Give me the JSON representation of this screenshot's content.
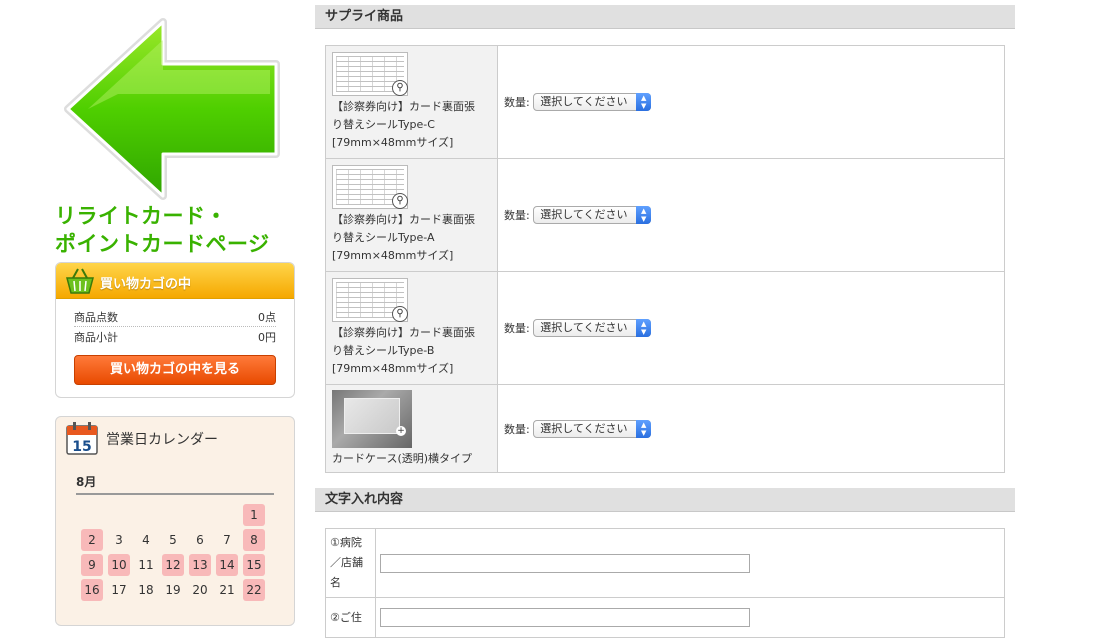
{
  "sidebar": {
    "banner": {
      "text_line1": "リライトカード・",
      "text_line2": "ポイントカードページ",
      "icon": "green-left-arrow-icon"
    },
    "cart": {
      "title": "買い物カゴの中",
      "rows": [
        {
          "label": "商品点数",
          "value": "0点"
        },
        {
          "label": "商品小計",
          "value": "0円"
        }
      ],
      "button_label": "買い物カゴの中を見る"
    },
    "calendar": {
      "title": "営業日カレンダー",
      "icon_day": "15",
      "month": "8月",
      "days": [
        {
          "d": "1",
          "holiday": true
        },
        {
          "d": "2",
          "holiday": true
        },
        {
          "d": "3",
          "holiday": false
        },
        {
          "d": "4",
          "holiday": false
        },
        {
          "d": "5",
          "holiday": false
        },
        {
          "d": "6",
          "holiday": false
        },
        {
          "d": "7",
          "holiday": false
        },
        {
          "d": "8",
          "holiday": true
        },
        {
          "d": "9",
          "holiday": true
        },
        {
          "d": "10",
          "holiday": true
        },
        {
          "d": "11",
          "holiday": false
        },
        {
          "d": "12",
          "holiday": true
        },
        {
          "d": "13",
          "holiday": true
        },
        {
          "d": "14",
          "holiday": true
        },
        {
          "d": "15",
          "holiday": true
        },
        {
          "d": "16",
          "holiday": true
        },
        {
          "d": "17",
          "holiday": false
        },
        {
          "d": "18",
          "holiday": false
        },
        {
          "d": "19",
          "holiday": false
        },
        {
          "d": "20",
          "holiday": false
        },
        {
          "d": "21",
          "holiday": false
        },
        {
          "d": "22",
          "holiday": true
        }
      ]
    }
  },
  "supply": {
    "heading": "サプライ商品",
    "qty_label": "数量:",
    "select_placeholder": "選択してください",
    "products": [
      {
        "line1": "【診察券向け】カード裏面張",
        "line2": "り替えシールType-C",
        "line3": "[79mm×48mmサイズ]"
      },
      {
        "line1": "【診察券向け】カード裏面張",
        "line2": "り替えシールType-A",
        "line3": "[79mm×48mmサイズ]"
      },
      {
        "line1": "【診察券向け】カード裏面張",
        "line2": "り替えシールType-B",
        "line3": "[79mm×48mmサイズ]"
      },
      {
        "line1": "カードケース(透明)横タイプ",
        "line2": "",
        "line3": ""
      }
    ]
  },
  "text_entry": {
    "heading": "文字入れ内容",
    "fields": [
      {
        "label": "①病院／店舗名",
        "value": ""
      },
      {
        "label": "②ご住",
        "value": ""
      }
    ]
  },
  "colors": {
    "banner_green": "#39b200",
    "cart_header": "#f5a800",
    "cart_button": "#e84a00",
    "holiday": "#f8b9b9"
  }
}
